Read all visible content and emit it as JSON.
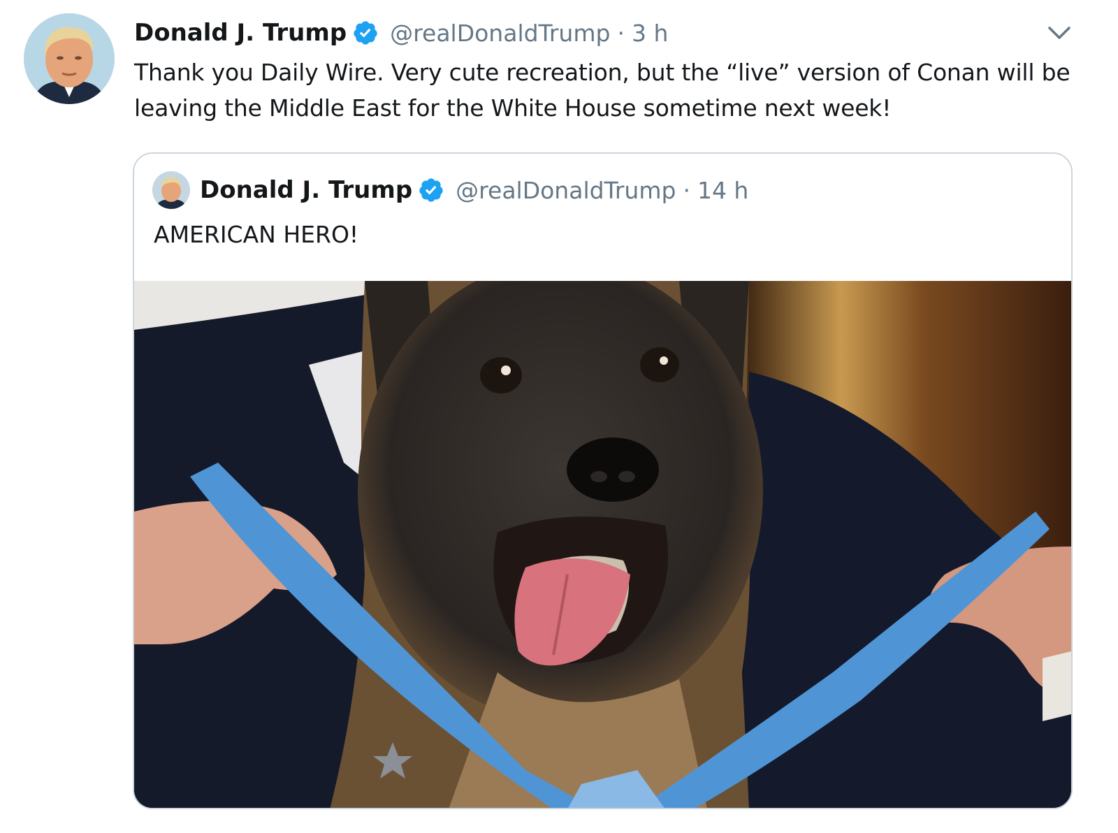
{
  "tweet": {
    "author_name": "Donald J. Trump",
    "handle": "@realDonaldTrump",
    "separator": "·",
    "time": "3 h",
    "text": "Thank you Daily Wire. Very cute recreation, but the “live” version of Conan will be leaving the Middle East for the White House sometime next week!",
    "verified_icon": "verified-badge-icon",
    "menu_icon": "chevron-down-icon"
  },
  "quoted_tweet": {
    "author_name": "Donald J. Trump",
    "handle": "@realDonaldTrump",
    "separator": "·",
    "time": "14 h",
    "text": "AMERICAN HERO!",
    "verified_icon": "verified-badge-icon"
  },
  "colors": {
    "verified_blue": "#1da1f2",
    "secondary_text": "#657786",
    "primary_text": "#14171a",
    "card_border": "#ccd6dd"
  }
}
